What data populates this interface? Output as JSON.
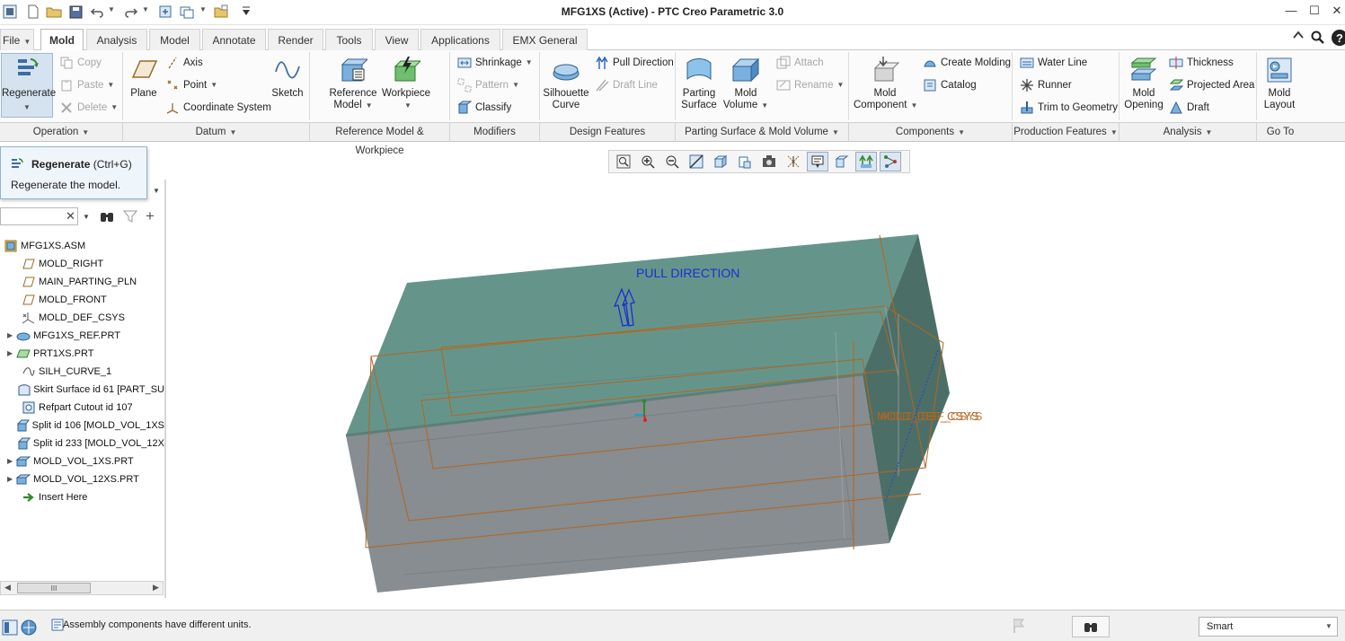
{
  "window": {
    "title": "MFG1XS (Active) - PTC Creo Parametric 3.0"
  },
  "tabs": [
    "File",
    "Mold",
    "Analysis",
    "Model",
    "Annotate",
    "Render",
    "Tools",
    "View",
    "Applications",
    "EMX General"
  ],
  "ribbon": {
    "operation": {
      "regenerate": "Regenerate",
      "copy": "Copy",
      "paste": "Paste",
      "delete": "Delete"
    },
    "datum": {
      "plane": "Plane",
      "axis": "Axis",
      "point": "Point",
      "coordinate_system": "Coordinate System",
      "sketch": "Sketch"
    },
    "reference": {
      "reference_model": "Reference",
      "reference_model_2": "Model",
      "workpiece": "Workpiece"
    },
    "modifiers": {
      "shrinkage": "Shrinkage",
      "pattern": "Pattern",
      "classify": "Classify"
    },
    "design": {
      "silhouette": "Silhouette",
      "silhouette_2": "Curve",
      "pull_direction": "Pull Direction",
      "draft_line": "Draft Line"
    },
    "parting": {
      "parting_surface": "Parting",
      "parting_surface_2": "Surface",
      "mold_volume": "Mold",
      "mold_volume_2": "Volume",
      "attach": "Attach",
      "rename": "Rename"
    },
    "components": {
      "mold_component": "Mold",
      "mold_component_2": "Component",
      "create_molding": "Create Molding",
      "catalog": "Catalog"
    },
    "production": {
      "water_line": "Water Line",
      "runner": "Runner",
      "trim_to_geometry": "Trim to Geometry"
    },
    "analysis": {
      "mold_opening": "Mold",
      "mold_opening_2": "Opening",
      "thickness": "Thickness",
      "projected_area": "Projected Area",
      "draft": "Draft"
    },
    "goto": {
      "mold_layout": "Mold",
      "mold_layout_2": "Layout"
    }
  },
  "groups": [
    "Operation",
    "Datum",
    "Reference Model & Workpiece",
    "Modifiers",
    "Design Features",
    "Parting Surface & Mold Volume",
    "Components",
    "Production Features",
    "Analysis",
    "Go To"
  ],
  "tooltip": {
    "title": "Regenerate",
    "shortcut": "(Ctrl+G)",
    "description": "Regenerate the model."
  },
  "tree": {
    "root": "MFG1XS.ASM",
    "items": [
      "MOLD_RIGHT",
      "MAIN_PARTING_PLN",
      "MOLD_FRONT",
      "MOLD_DEF_CSYS",
      "MFG1XS_REF.PRT",
      "PRT1XS.PRT",
      "SILH_CURVE_1",
      "Skirt Surface id 61 [PART_SU",
      "Refpart Cutout id 107",
      "Split id 106 [MOLD_VOL_1XS",
      "Split id 233 [MOLD_VOL_12X",
      "MOLD_VOL_1XS.PRT",
      "MOLD_VOL_12XS.PRT",
      "Insert Here"
    ],
    "scroll_label": "III"
  },
  "viewport": {
    "pull_direction_label": "PULL DIRECTION",
    "csys_label": "MOLD_DEF_CSYS"
  },
  "status": {
    "message": "Assembly components have different units.",
    "filter": "Smart"
  },
  "colors": {
    "model_top": "#65958a",
    "model_front": "#868d91",
    "model_side": "#4a7068",
    "outline": "#b5651d",
    "label_blue": "#1a2ed6",
    "accent": "#2a6fb5"
  }
}
